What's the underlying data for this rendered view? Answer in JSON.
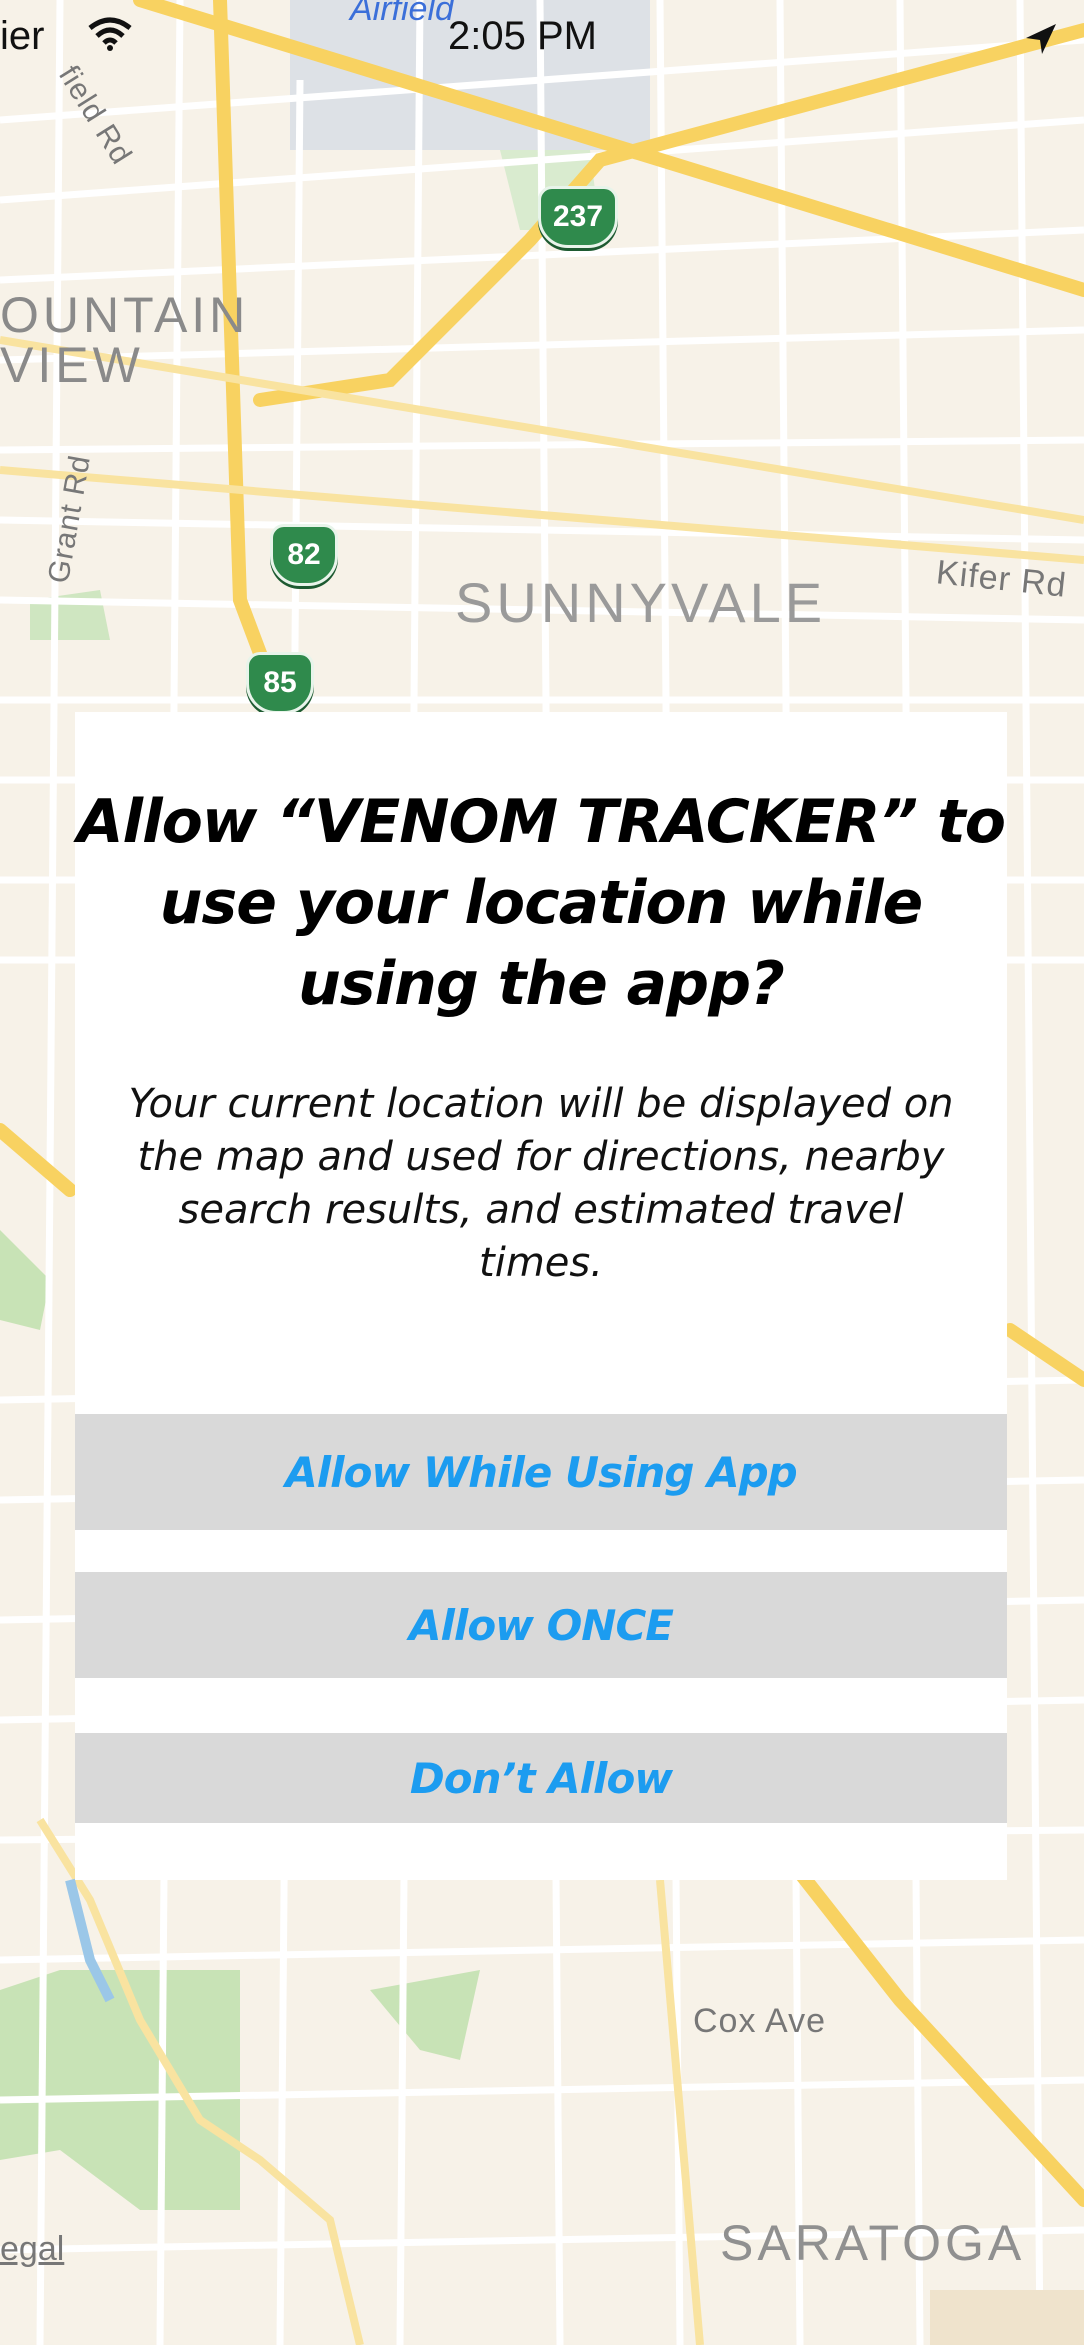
{
  "status_bar": {
    "carrier": "ier",
    "time": "2:05 PM"
  },
  "map": {
    "labels": {
      "airfield": "Airfield",
      "mountain_view_1": "OUNTAIN",
      "mountain_view_2": "VIEW",
      "sunnyvale": "SUNNYVALE",
      "saratoga": "SARATOGA",
      "cox_ave": "Cox Ave",
      "kifer_rd": "Kifer Rd",
      "grant_rd": "Grant Rd",
      "field_rd": "field Rd",
      "legal": "egal"
    },
    "shields": {
      "hwy_237": "237",
      "hwy_82": "82",
      "hwy_85": "85"
    }
  },
  "dialog": {
    "title": "Allow “VENOM TRACKER” to use your location while using the app?",
    "message": "Your current location will be displayed on the map and used for directions, nearby search results, and estimated travel times.",
    "buttons": {
      "allow_while_using": "Allow While Using App",
      "allow_once": "Allow ONCE",
      "dont_allow": "Don’t Allow"
    },
    "accent_color": "#1c9cf0"
  }
}
